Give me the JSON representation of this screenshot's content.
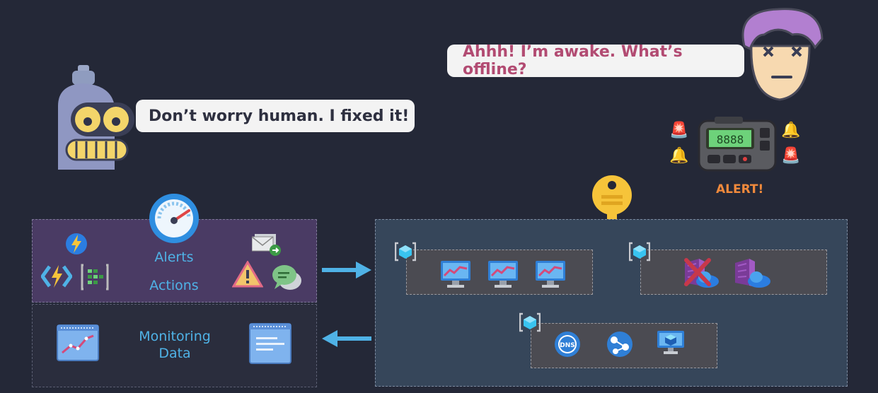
{
  "robot_speech": "Don’t worry human. I fixed it!",
  "human_speech": "Ahhh! I’m awake. What’s offline?",
  "alert_label": "ALERT!",
  "pager_display": "8888",
  "panel_alerts": {
    "line1": "Alerts",
    "line2": "Actions"
  },
  "panel_monitoring": {
    "line1": "Monitoring",
    "line2": "Data"
  },
  "dns_label": "DNS",
  "icons": [
    "robot-icon",
    "human-face-icon",
    "pager-icon",
    "alarm-icon",
    "key-icon",
    "gauge-icon",
    "function-app-icon",
    "automation-icon",
    "log-analytics-icon",
    "email-action-icon",
    "warning-icon",
    "chat-icon",
    "metrics-chart-icon",
    "logs-document-icon",
    "resource-group-icon",
    "monitor-vm-icon",
    "container-registry-icon",
    "dns-icon",
    "network-icon",
    "vm-icon"
  ],
  "colors": {
    "background": "#242837",
    "accent_blue": "#4fb2e6",
    "alert_orange": "#f18a3c",
    "human_text": "#b24b72"
  }
}
